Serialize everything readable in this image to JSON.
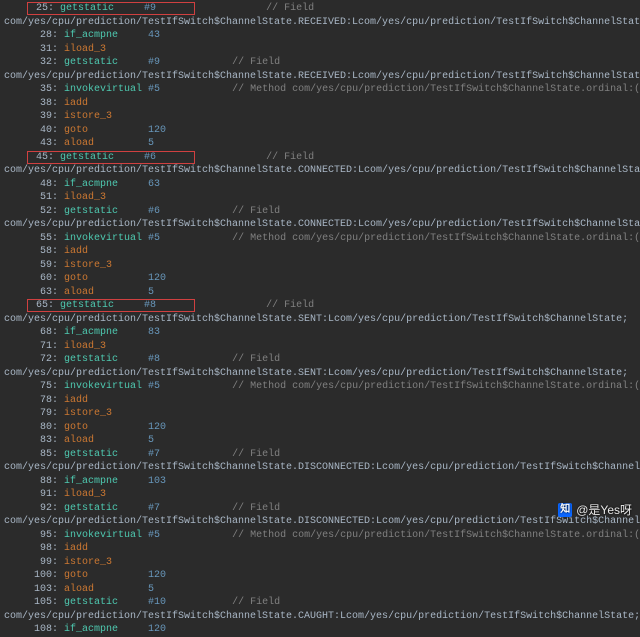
{
  "watermark_text": "@是Yes呀",
  "zh_logo_text": "知",
  "lines": [
    {
      "off": "25:",
      "hl": true,
      "op": "getstatic",
      "opcls": "gcall",
      "arg": "#9",
      "cmt": "// Field"
    },
    {
      "wrap": "com/yes/cpu/prediction/TestIfSwitch$ChannelState.RECEIVED:Lcom/yes/cpu/prediction/TestIfSwitch$ChannelState;"
    },
    {
      "off": "28:",
      "op": "if_acmpne",
      "opcls": "gcall",
      "arg": "43"
    },
    {
      "off": "31:",
      "op": "iload_3",
      "opcls": "kw"
    },
    {
      "off": "32:",
      "op": "getstatic",
      "opcls": "gcall",
      "arg": "#9",
      "cmt": "// Field"
    },
    {
      "wrap": "com/yes/cpu/prediction/TestIfSwitch$ChannelState.RECEIVED:Lcom/yes/cpu/prediction/TestIfSwitch$ChannelState;"
    },
    {
      "off": "35:",
      "op": "invokevirtual",
      "opcls": "gcall",
      "arg": "#5",
      "cmt": "// Method com/yes/cpu/prediction/TestIfSwitch$ChannelState.ordinal:()I"
    },
    {
      "off": "38:",
      "op": "iadd",
      "opcls": "kw"
    },
    {
      "off": "39:",
      "op": "istore_3",
      "opcls": "kw"
    },
    {
      "off": "40:",
      "op": "goto",
      "opcls": "kw",
      "arg": "120"
    },
    {
      "off": "43:",
      "op": "aload",
      "opcls": "kw",
      "arg": "5"
    },
    {
      "off": "45:",
      "hl": true,
      "op": "getstatic",
      "opcls": "gcall",
      "arg": "#6",
      "cmt": "// Field"
    },
    {
      "wrap": "com/yes/cpu/prediction/TestIfSwitch$ChannelState.CONNECTED:Lcom/yes/cpu/prediction/TestIfSwitch$ChannelState;"
    },
    {
      "off": "48:",
      "op": "if_acmpne",
      "opcls": "gcall",
      "arg": "63"
    },
    {
      "off": "51:",
      "op": "iload_3",
      "opcls": "kw"
    },
    {
      "off": "52:",
      "op": "getstatic",
      "opcls": "gcall",
      "arg": "#6",
      "cmt": "// Field"
    },
    {
      "wrap": "com/yes/cpu/prediction/TestIfSwitch$ChannelState.CONNECTED:Lcom/yes/cpu/prediction/TestIfSwitch$ChannelState;"
    },
    {
      "off": "55:",
      "op": "invokevirtual",
      "opcls": "gcall",
      "arg": "#5",
      "cmt": "// Method com/yes/cpu/prediction/TestIfSwitch$ChannelState.ordinal:()I"
    },
    {
      "off": "58:",
      "op": "iadd",
      "opcls": "kw"
    },
    {
      "off": "59:",
      "op": "istore_3",
      "opcls": "kw"
    },
    {
      "off": "60:",
      "op": "goto",
      "opcls": "kw",
      "arg": "120"
    },
    {
      "off": "63:",
      "op": "aload",
      "opcls": "kw",
      "arg": "5"
    },
    {
      "off": "65:",
      "hl": true,
      "op": "getstatic",
      "opcls": "gcall",
      "arg": "#8",
      "cmt": "// Field"
    },
    {
      "wrap": "com/yes/cpu/prediction/TestIfSwitch$ChannelState.SENT:Lcom/yes/cpu/prediction/TestIfSwitch$ChannelState;"
    },
    {
      "off": "68:",
      "op": "if_acmpne",
      "opcls": "gcall",
      "arg": "83"
    },
    {
      "off": "71:",
      "op": "iload_3",
      "opcls": "kw"
    },
    {
      "off": "72:",
      "op": "getstatic",
      "opcls": "gcall",
      "arg": "#8",
      "cmt": "// Field"
    },
    {
      "wrap": "com/yes/cpu/prediction/TestIfSwitch$ChannelState.SENT:Lcom/yes/cpu/prediction/TestIfSwitch$ChannelState;"
    },
    {
      "off": "75:",
      "op": "invokevirtual",
      "opcls": "gcall",
      "arg": "#5",
      "cmt": "// Method com/yes/cpu/prediction/TestIfSwitch$ChannelState.ordinal:()I"
    },
    {
      "off": "78:",
      "op": "iadd",
      "opcls": "kw"
    },
    {
      "off": "79:",
      "op": "istore_3",
      "opcls": "kw"
    },
    {
      "off": "80:",
      "op": "goto",
      "opcls": "kw",
      "arg": "120"
    },
    {
      "off": "83:",
      "op": "aload",
      "opcls": "kw",
      "arg": "5"
    },
    {
      "off": "85:",
      "op": "getstatic",
      "opcls": "gcall",
      "arg": "#7",
      "cmt": "// Field"
    },
    {
      "wrap": "com/yes/cpu/prediction/TestIfSwitch$ChannelState.DISCONNECTED:Lcom/yes/cpu/prediction/TestIfSwitch$ChannelState;"
    },
    {
      "off": "88:",
      "op": "if_acmpne",
      "opcls": "gcall",
      "arg": "103"
    },
    {
      "off": "91:",
      "op": "iload_3",
      "opcls": "kw"
    },
    {
      "off": "92:",
      "op": "getstatic",
      "opcls": "gcall",
      "arg": "#7",
      "cmt": "// Field"
    },
    {
      "wrap": "com/yes/cpu/prediction/TestIfSwitch$ChannelState.DISCONNECTED:Lcom/yes/cpu/prediction/TestIfSwitch$ChannelState;"
    },
    {
      "off": "95:",
      "op": "invokevirtual",
      "opcls": "gcall",
      "arg": "#5",
      "cmt": "// Method com/yes/cpu/prediction/TestIfSwitch$ChannelState.ordinal:()I"
    },
    {
      "off": "98:",
      "op": "iadd",
      "opcls": "kw"
    },
    {
      "off": "99:",
      "op": "istore_3",
      "opcls": "kw"
    },
    {
      "off": "100:",
      "op": "goto",
      "opcls": "kw",
      "arg": "120"
    },
    {
      "off": "103:",
      "op": "aload",
      "opcls": "kw",
      "arg": "5"
    },
    {
      "off": "105:",
      "op": "getstatic",
      "opcls": "gcall",
      "arg": "#10",
      "cmt": "// Field"
    },
    {
      "wrap": "com/yes/cpu/prediction/TestIfSwitch$ChannelState.CAUGHT:Lcom/yes/cpu/prediction/TestIfSwitch$ChannelState;"
    },
    {
      "off": "108:",
      "op": "if_acmpne",
      "opcls": "gcall",
      "arg": "120"
    }
  ]
}
